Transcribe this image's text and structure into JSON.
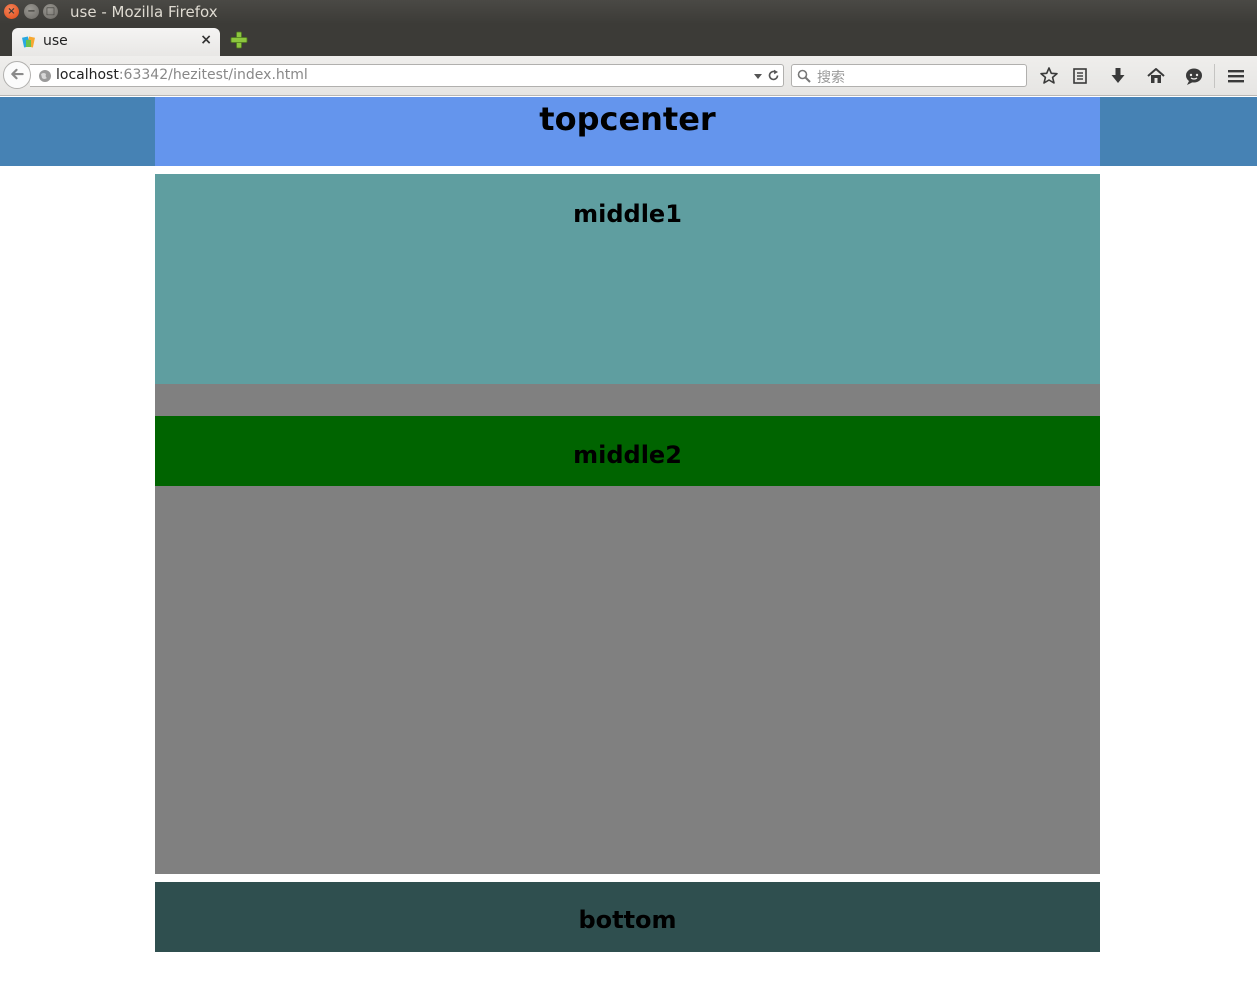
{
  "window": {
    "title": "use - Mozilla Firefox",
    "close_symbol": "×",
    "minimize_symbol": "−",
    "maximize_symbol": "□"
  },
  "tabs": [
    {
      "label": "use",
      "close": "×",
      "favicon": "page-favicon-icon"
    }
  ],
  "navbar": {
    "url_host": "localhost",
    "url_rest": ":63342/hezitest/index.html",
    "search_placeholder": "搜索"
  },
  "icons": {
    "back": "back-arrow-icon",
    "site_identity": "globe-icon",
    "url_dropdown": "dropdown-arrow-icon",
    "reload": "reload-icon",
    "search": "search-icon",
    "bookmark": "star-icon",
    "reading_list": "reading-list-icon",
    "downloads": "download-icon",
    "home": "home-icon",
    "chat": "chat-icon",
    "menu": "hamburger-menu-icon",
    "new_tab": "plus-icon"
  },
  "page": {
    "topcenter": "topcenter",
    "middle1": "middle1",
    "middle2": "middle2",
    "bottom": "bottom"
  },
  "colors": {
    "top": "#4682b4",
    "topcenter": "#6495ed",
    "middle1": "#5f9ea0",
    "middle2": "#006400",
    "middle_background": "#808080",
    "bottom": "#2f4f4f"
  }
}
